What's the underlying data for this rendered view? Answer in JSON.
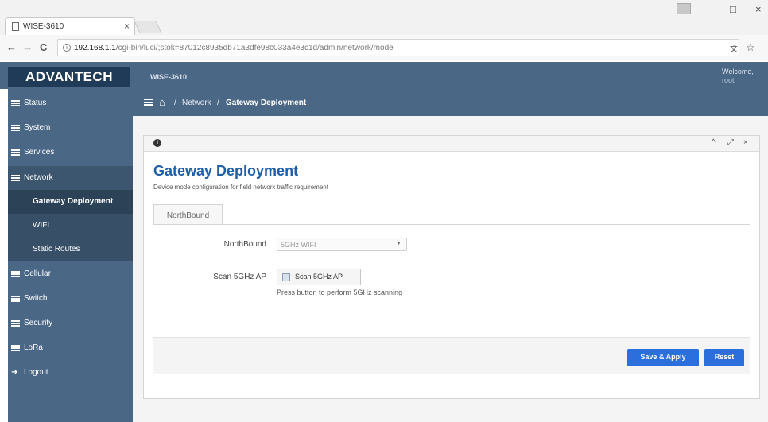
{
  "browser": {
    "tab_title": "WISE-3610",
    "tab_close": "×",
    "url_host": "192.168.1.1",
    "url_path": "/cgi-bin/luci/;stok=87012c8935db71a3dfe98c033a4e3c1d/admin/network/mode",
    "info_glyph": "i",
    "back_glyph": "←",
    "forward_glyph": "→",
    "reload_glyph": "C",
    "translate_glyph": "文",
    "star_glyph": "☆",
    "minimize_glyph": "–",
    "maximize_glyph": "□",
    "close_glyph": "×"
  },
  "header": {
    "logo": "ADVANTECH",
    "product": "WISE-3610",
    "welcome": "Welcome,",
    "username": "root"
  },
  "sidebar": {
    "items": [
      {
        "label": "Status"
      },
      {
        "label": "System"
      },
      {
        "label": "Services"
      },
      {
        "label": "Network"
      },
      {
        "label": "Gateway Deployment"
      },
      {
        "label": "WIFI"
      },
      {
        "label": "Static Routes"
      },
      {
        "label": "Cellular"
      },
      {
        "label": "Switch"
      },
      {
        "label": "Security"
      },
      {
        "label": "LoRa"
      },
      {
        "label": "Logout"
      }
    ],
    "logout_glyph": "➜"
  },
  "breadcrumb": {
    "home_glyph": "⌂",
    "sep1": "/",
    "network": "Network",
    "sep2": "/",
    "current": "Gateway Deployment"
  },
  "panel": {
    "info_glyph": "i",
    "collapse_glyph": "^",
    "expand_glyph": "⤢",
    "close_glyph": "×",
    "title": "Gateway Deployment",
    "description": "Device mode configuration for field network traffic requirement",
    "tab": "NorthBound",
    "northbound_label": "NorthBound",
    "northbound_value": "5GHz WIFI",
    "select_arrow": "▼",
    "scan_label": "Scan 5GHz AP",
    "scan_button": "Scan 5GHz AP",
    "scan_help": "Press button to perform 5GHz scanning",
    "save_apply": "Save & Apply",
    "reset": "Reset"
  },
  "colors": {
    "header_bg": "#4a6785",
    "logo_bg": "#1f3b57",
    "title_blue": "#1f5fa8",
    "button_blue": "#2a6fdb"
  }
}
